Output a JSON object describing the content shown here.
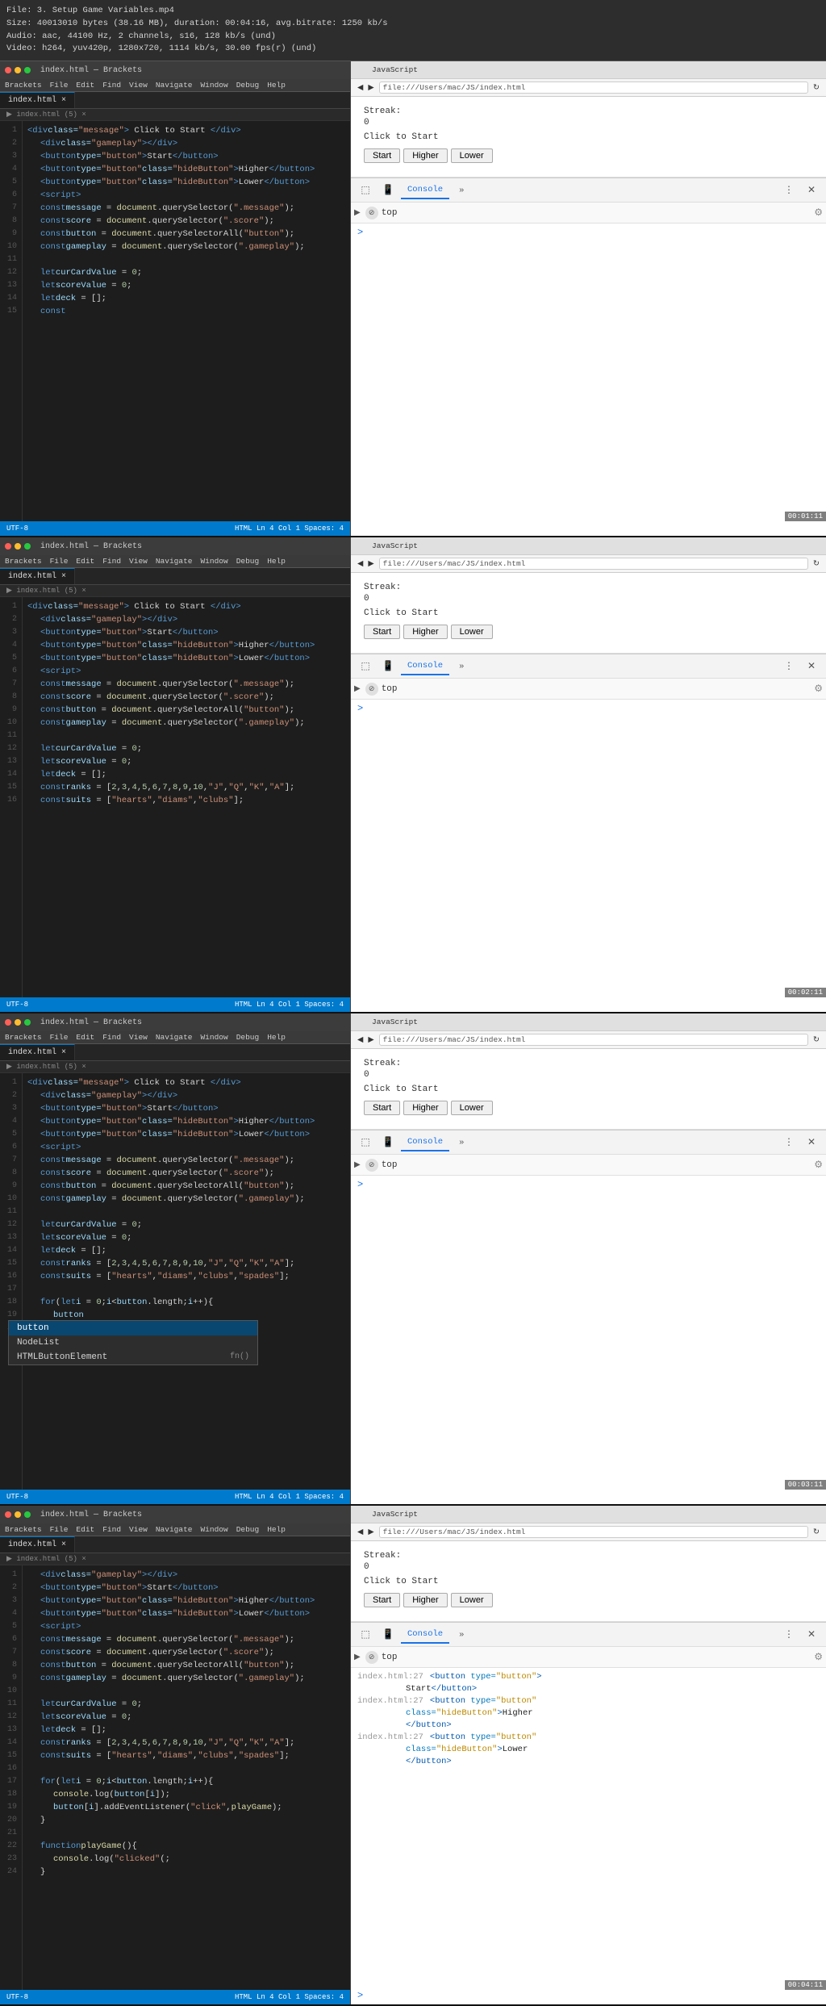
{
  "videoHeader": {
    "line1": "File: 3. Setup Game Variables.mp4",
    "line2": "Size: 40013010 bytes (38.16 MB), duration: 00:04:16, avg.bitrate: 1250 kb/s",
    "line3": "Audio: aac, 44100 Hz, 2 channels, s16, 128 kb/s (und)",
    "line4": "Video: h264, yuv420p, 1280x720, 1114 kb/s, 30.00 fps(r) (und)"
  },
  "frames": [
    {
      "id": "frame1",
      "timestamp": "00:01:11",
      "editor": {
        "title": "index.html — Brackets",
        "tabs": [
          "index.html"
        ],
        "filepath": "index.html (5) ×",
        "codeLines": [
          "<div class=\"message\"> Click to Start </div>",
          "    <div class=\"gameplay\"></div>",
          "    <button type=\"button\" >Start</button>",
          "    <button type=\"button\"class=\"hideButton\">Higher</button>",
          "    <button type=\"button\"class=\"hideButton\">Lower</button>",
          "    <script>",
          "    const message = document.querySelector(\".message\");",
          "    const score = document.querySelector(\".score\");",
          "    const button = document.querySelectorAll(\"button\");",
          "    const gameplay = document.querySelector(\".gameplay\");",
          "",
          "    let curCardValue = 0;",
          "    let scoreValue = 0;",
          "    let deck = [];",
          "    const"
        ],
        "statusBar": "UTF-8  HTML  Ln 4  Col 1  Spaces: 4"
      },
      "browser": {
        "url": "file:///Users/mac/JS/index.html",
        "game": {
          "streakLabel": "Streak:",
          "streakValue": "0",
          "clickToStart": "Click to Start",
          "buttons": [
            "Start",
            "Higher",
            "Lower"
          ]
        },
        "devtools": {
          "tab": "Console",
          "inputValue": "top",
          "consoleChevron": ">"
        }
      }
    },
    {
      "id": "frame2",
      "timestamp": "00:02:11",
      "editor": {
        "title": "index.html — Brackets",
        "tabs": [
          "index.html"
        ],
        "filepath": "index.html (5) ×",
        "codeLines": [
          "<div class=\"message\"> Click to Start </div>",
          "    <div class=\"gameplay\"></div>",
          "    <button type=\"button\" >Start</button>",
          "    <button type=\"button\"class=\"hideButton\">Higher</button>",
          "    <button type=\"button\"class=\"hideButton\">Lower</button>",
          "    <script>",
          "    const message = document.querySelector(\".message\");",
          "    const score = document.querySelector(\".score\");",
          "    const button = document.querySelectorAll(\"button\");",
          "    const gameplay = document.querySelector(\".gameplay\");",
          "",
          "    let curCardValue = 0;",
          "    let scoreValue = 0;",
          "    let deck = [];",
          "    const ranks = [2,3,4,5,6,7,8,9,10,\"J\",\"Q\",\"K\",\"A\"];",
          "    const suits = [\"hearts\",\"diams\",\"clubs\"];"
        ],
        "statusBar": "UTF-8  HTML  Ln 4  Col 1  Spaces: 4"
      },
      "browser": {
        "url": "file:///Users/mac/JS/index.html",
        "game": {
          "streakLabel": "Streak:",
          "streakValue": "0",
          "clickToStart": "Click to Start",
          "buttons": [
            "Start",
            "Higher",
            "Lower"
          ]
        },
        "devtools": {
          "tab": "Console",
          "inputValue": "top",
          "consoleChevron": ">"
        }
      }
    },
    {
      "id": "frame3",
      "timestamp": "00:03:11",
      "editor": {
        "title": "index.html — Brackets",
        "tabs": [
          "index.html"
        ],
        "filepath": "index.html (5) ×",
        "codeLines": [
          "<div class=\"message\"> Click to Start </div>",
          "    <div class=\"gameplay\"></div>",
          "    <button type=\"button\" >Start</button>",
          "    <button type=\"button\"class=\"hideButton\">Higher</button>",
          "    <button type=\"button\"class=\"hideButton\">Lower</button>",
          "    <script>",
          "    const message = document.querySelector(\".message\");",
          "    const score = document.querySelector(\".score\");",
          "    const button = document.querySelectorAll(\"button\");",
          "    const gameplay = document.querySelector(\".gameplay\");",
          "",
          "    let curCardValue = 0;",
          "    let scoreValue = 0;",
          "    let deck = [];",
          "    const ranks = [2,3,4,5,6,7,8,9,10,\"J\",\"Q\",\"K\",\"A\"];",
          "    const suits = [\"hearts\",\"diams\",\"clubs\",\"spades\"];",
          "",
          "    for(let i = 0;i<button.length;i++){",
          "        button",
          "    }"
        ],
        "statusBar": "UTF-8  HTML  Ln 4  Col 1  Spaces: 4",
        "autocomplete": {
          "items": [
            {
              "label": "button",
              "type": "",
              "selected": true
            },
            {
              "label": "NodeList",
              "type": ""
            },
            {
              "label": "HTMLButtonElement",
              "type": "fn()"
            }
          ]
        }
      },
      "browser": {
        "url": "file:///Users/mac/JS/index.html",
        "game": {
          "streakLabel": "Streak:",
          "streakValue": "0",
          "clickToStart": "Click to Start",
          "buttons": [
            "Start",
            "Higher",
            "Lower"
          ]
        },
        "devtools": {
          "tab": "Console",
          "inputValue": "top",
          "consoleChevron": ">"
        }
      }
    },
    {
      "id": "frame4",
      "timestamp": "00:04:11",
      "editor": {
        "title": "index.html — Brackets",
        "tabs": [
          "index.html"
        ],
        "filepath": "index.html (5) ×",
        "codeLines": [
          "<div class=\"gameplay\"></div>",
          "    <button type=\"button\" >Start</button>",
          "    <button type=\"button\"class=\"hideButton\">Higher</button>",
          "    <button type=\"button\"class=\"hideButton\">Lower</button>",
          "    <script>",
          "    const message = document.querySelector(\".message\");",
          "    const score = document.querySelector(\".score\");",
          "    const button = document.querySelectorAll(\"button\");",
          "    const gameplay = document.querySelector(\".gameplay\");",
          "",
          "    let curCardValue = 0;",
          "    let scoreValue = 0;",
          "    let deck = [];",
          "    const ranks = [2,3,4,5,6,7,8,9,10,\"J\",\"Q\",\"K\",\"A\"];",
          "    const suits = [\"hearts\",\"diams\",\"clubs\",\"spades\"];",
          "",
          "    for(let i = 0;i<button.length;i++){",
          "        console.log(button[i]);",
          "        button[i].addEventListener(\"click\",playGame);",
          "    }",
          "",
          "    function playGame(){",
          "        console.log(\"clicked\"(;",
          "    }"
        ],
        "statusBar": "UTF-8  HTML  Ln 4  Col 1  Spaces: 4"
      },
      "browser": {
        "url": "file:///Users/mac/JS/index.html",
        "game": {
          "streakLabel": "Streak:",
          "streakValue": "0",
          "clickToStart": "Click to Start",
          "buttons": [
            "Start",
            "Higher",
            "Lower"
          ]
        },
        "devtools": {
          "tab": "Console",
          "inputValue": "top",
          "consoleChevron": ">",
          "sourceLines": [
            {
              "lineNum": "index.html:27",
              "code": "<button type=\"button\">"
            },
            {
              "lineNum": "",
              "code": "  Start</button>"
            },
            {
              "lineNum": "index.html:27",
              "code": "<button type=\"button\""
            },
            {
              "lineNum": "",
              "code": "  class=\"hideButton\">Higher"
            },
            {
              "lineNum": "",
              "code": "</button>"
            },
            {
              "lineNum": "index.html:27",
              "code": "<button type=\"button\""
            },
            {
              "lineNum": "",
              "code": "  class=\"hideButton\">Lower"
            },
            {
              "lineNum": "",
              "code": "</button>"
            }
          ]
        }
      }
    }
  ],
  "colors": {
    "editorBg": "#1d1d1d",
    "browserBg": "#ffffff",
    "accentBlue": "#007acc",
    "keyword": "#569cd6",
    "string": "#ce9178",
    "number": "#b5cea8",
    "variable": "#9cdcfe",
    "function_color": "#dcdcaa",
    "comment": "#6a9955"
  }
}
